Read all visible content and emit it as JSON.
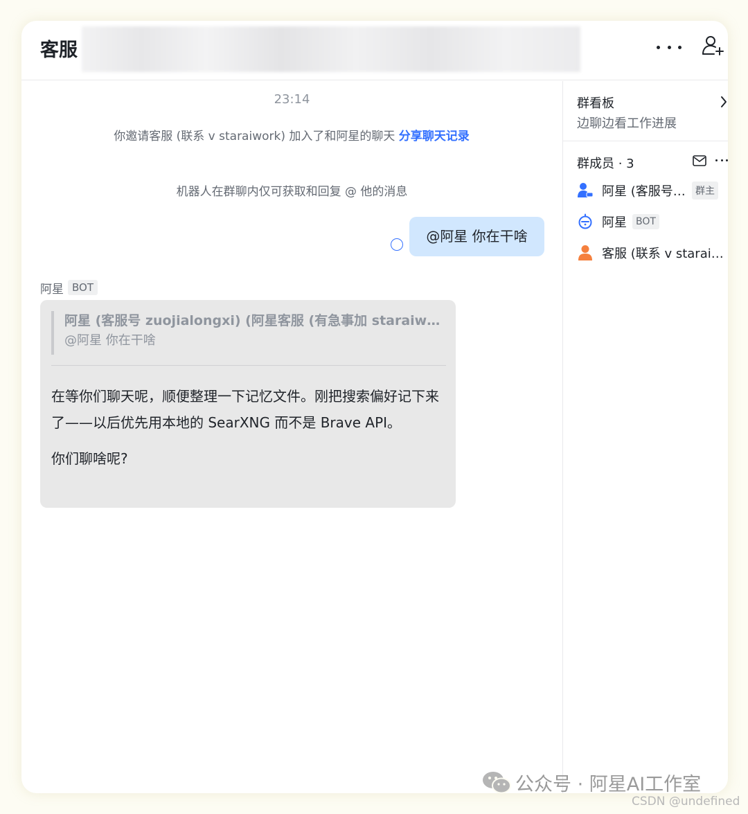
{
  "header": {
    "title": "客服"
  },
  "chat": {
    "time": "23:14",
    "system_message": "你邀请客服 (联系 v staraiwork) 加入了和阿星的聊天 ",
    "share_link": "分享聊天记录",
    "system_note": "机器人在群聊内仅可获取和回复 @ 他的消息",
    "outgoing_message": "@阿星 你在干啥",
    "sender_name": "阿星",
    "sender_tag": "BOT",
    "quote_title": "阿星 (客服号 zuojialongxi) (阿星客服 (有急事加 staraiwork)",
    "quote_text": "@阿星 你在干啥",
    "reply_paragraph_1": "在等你们聊天呢，顺便整理一下记忆文件。刚把搜索偏好记下来了——以后优先用本地的 SearXNG 而不是 Brave API。",
    "reply_paragraph_2": "你们聊啥呢?"
  },
  "sidebar": {
    "board_title": "群看板",
    "board_subtitle": "边聊边看工作进展",
    "members_label": "群成员 · 3",
    "members": [
      {
        "name": "阿星 (客服号 zuojialongxi)",
        "badge": "群主",
        "icon": "user-admin-icon",
        "color": "#3370ff"
      },
      {
        "name": "阿星",
        "badge": "BOT",
        "icon": "bot-icon",
        "color": "#3370ff"
      },
      {
        "name": "客服 (联系 v staraiwork)",
        "badge": "",
        "icon": "user-icon",
        "color": "#f5803e"
      }
    ]
  },
  "watermark": {
    "text": "公众号 · 阿星AI工作室",
    "csdn": "CSDN @undefined"
  }
}
